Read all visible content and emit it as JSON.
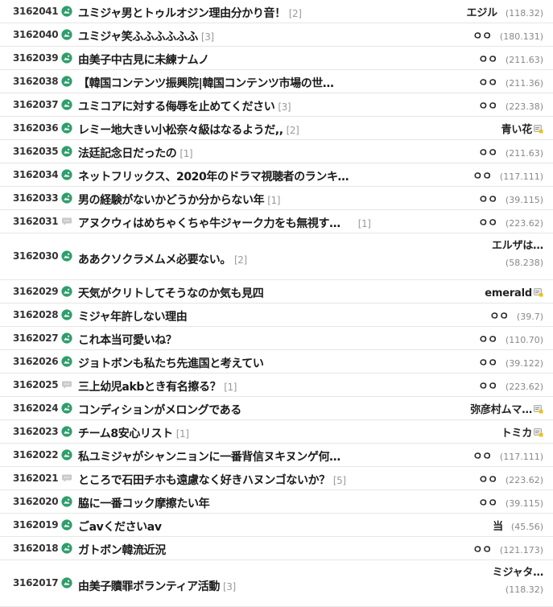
{
  "colors": {
    "accent": "#2f9e6b",
    "comment": "#999999",
    "ip": "#888888",
    "row_border": "#e6e6e6"
  },
  "icons": {
    "image_post": "image-post-icon",
    "text_post": "speech-bubble-icon",
    "fixed_nick": "fixed-nick-icon"
  },
  "posts": [
    {
      "no": "3162041",
      "icon": "image",
      "title": "ユミジャ男とトゥルオジン理由分かり音！",
      "comments": "[2]",
      "nick": "エジル",
      "ip": "(118.32)",
      "fixed": false
    },
    {
      "no": "3162040",
      "icon": "image",
      "title": "ユミジャ笑ふふふふふふ",
      "comments": "[3]",
      "nick": "ㅇㅇ",
      "ip": "(180.131)",
      "fixed": false
    },
    {
      "no": "3162039",
      "icon": "image",
      "title": "由美子中古見に未練ナムノ",
      "comments": "",
      "nick": "ㅇㅇ",
      "ip": "(211.63)",
      "fixed": false
    },
    {
      "no": "3162038",
      "icon": "image",
      "title": "【韓国コンテンツ振興院|韓国コンテンツ市場の世…",
      "comments": "",
      "nick": "ㅇㅇ",
      "ip": "(211.36)",
      "fixed": false
    },
    {
      "no": "3162037",
      "icon": "image",
      "title": "ユミコアに対する侮辱を止めてください",
      "comments": "[3]",
      "nick": "ㅇㅇ",
      "ip": "(223.38)",
      "fixed": false
    },
    {
      "no": "3162036",
      "icon": "image",
      "title": "レミー地大きい小松奈々級はなるようだ,,",
      "comments": "[2]",
      "nick": "青い花",
      "ip": "",
      "fixed": true
    },
    {
      "no": "3162035",
      "icon": "image",
      "title": "法廷記念日だったの",
      "comments": "[1]",
      "nick": "ㅇㅇ",
      "ip": "(211.63)",
      "fixed": false
    },
    {
      "no": "3162034",
      "icon": "image",
      "title": "ネットフリックス、2020年のドラマ視聴者のランキ…",
      "comments": "",
      "nick": "ㅇㅇ",
      "ip": "(117.111)",
      "fixed": false
    },
    {
      "no": "3162033",
      "icon": "image",
      "title": "男の経験がないかどうか分からない年",
      "comments": "[1]",
      "nick": "ㅇㅇ",
      "ip": "(39.115)",
      "fixed": false
    },
    {
      "no": "3162031",
      "icon": "text",
      "title": "アヌクウィはめちゃくちゃ牛ジャーク力をも無視す…",
      "comments": "[1]",
      "nick": "ㅇㅇ",
      "ip": "(223.62)",
      "fixed": false
    },
    {
      "no": "3162030",
      "icon": "image",
      "title": "ああクソクラメムメ必要ない。",
      "comments": "[2]",
      "nick": "エルザは…",
      "ip": "(58.238)",
      "fixed": false,
      "tall": true
    },
    {
      "no": "3162029",
      "icon": "image",
      "title": "天気がクリトしてそうなのか気も見四",
      "comments": "",
      "nick": "emerald",
      "ip": "",
      "fixed": true
    },
    {
      "no": "3162028",
      "icon": "image",
      "title": "ミジャ年許しない理由",
      "comments": "",
      "nick": "ㅇㅇ",
      "ip": "(39.7)",
      "fixed": false
    },
    {
      "no": "3162027",
      "icon": "image",
      "title": "これ本当可愛いね？",
      "comments": "",
      "nick": "ㅇㅇ",
      "ip": "(110.70)",
      "fixed": false
    },
    {
      "no": "3162026",
      "icon": "image",
      "title": "ジョトボンも私たち先進国と考えてい",
      "comments": "",
      "nick": "ㅇㅇ",
      "ip": "(39.122)",
      "fixed": false
    },
    {
      "no": "3162025",
      "icon": "text",
      "title": "三上幼児akbとき有名擦る？",
      "comments": "[1]",
      "nick": "ㅇㅇ",
      "ip": "(223.62)",
      "fixed": false
    },
    {
      "no": "3162024",
      "icon": "image",
      "title": "コンディションがメロングである",
      "comments": "",
      "nick": "弥彦村ムマ…",
      "ip": "",
      "fixed": true
    },
    {
      "no": "3162023",
      "icon": "image",
      "title": "チーム8安心リスト",
      "comments": "[1]",
      "nick": "トミカ",
      "ip": "",
      "fixed": true
    },
    {
      "no": "3162022",
      "icon": "image",
      "title": "私ユミジャがシャンニョンに一番背信ヌキヌンゲ何…",
      "comments": "",
      "nick": "ㅇㅇ",
      "ip": "(117.111)",
      "fixed": false
    },
    {
      "no": "3162021",
      "icon": "text",
      "title": "ところで石田チホも遠慮なく好きハヌンゴないか？",
      "comments": "[5]",
      "nick": "ㅇㅇ",
      "ip": "(223.62)",
      "fixed": false
    },
    {
      "no": "3162020",
      "icon": "image",
      "title": "脇に一番コック摩擦たい年",
      "comments": "",
      "nick": "ㅇㅇ",
      "ip": "(39.115)",
      "fixed": false
    },
    {
      "no": "3162019",
      "icon": "image",
      "title": "ごavくださいav",
      "comments": "",
      "nick": "当",
      "ip": "(45.56)",
      "fixed": false
    },
    {
      "no": "3162018",
      "icon": "image",
      "title": "ガトボン韓流近況",
      "comments": "",
      "nick": "ㅇㅇ",
      "ip": "(121.173)",
      "fixed": false
    },
    {
      "no": "3162017",
      "icon": "image",
      "title": "由美子贖罪ボランティア活動",
      "comments": "[3]",
      "nick": "ミジャタ…",
      "ip": "(118.32)",
      "fixed": false,
      "tall": true
    }
  ]
}
